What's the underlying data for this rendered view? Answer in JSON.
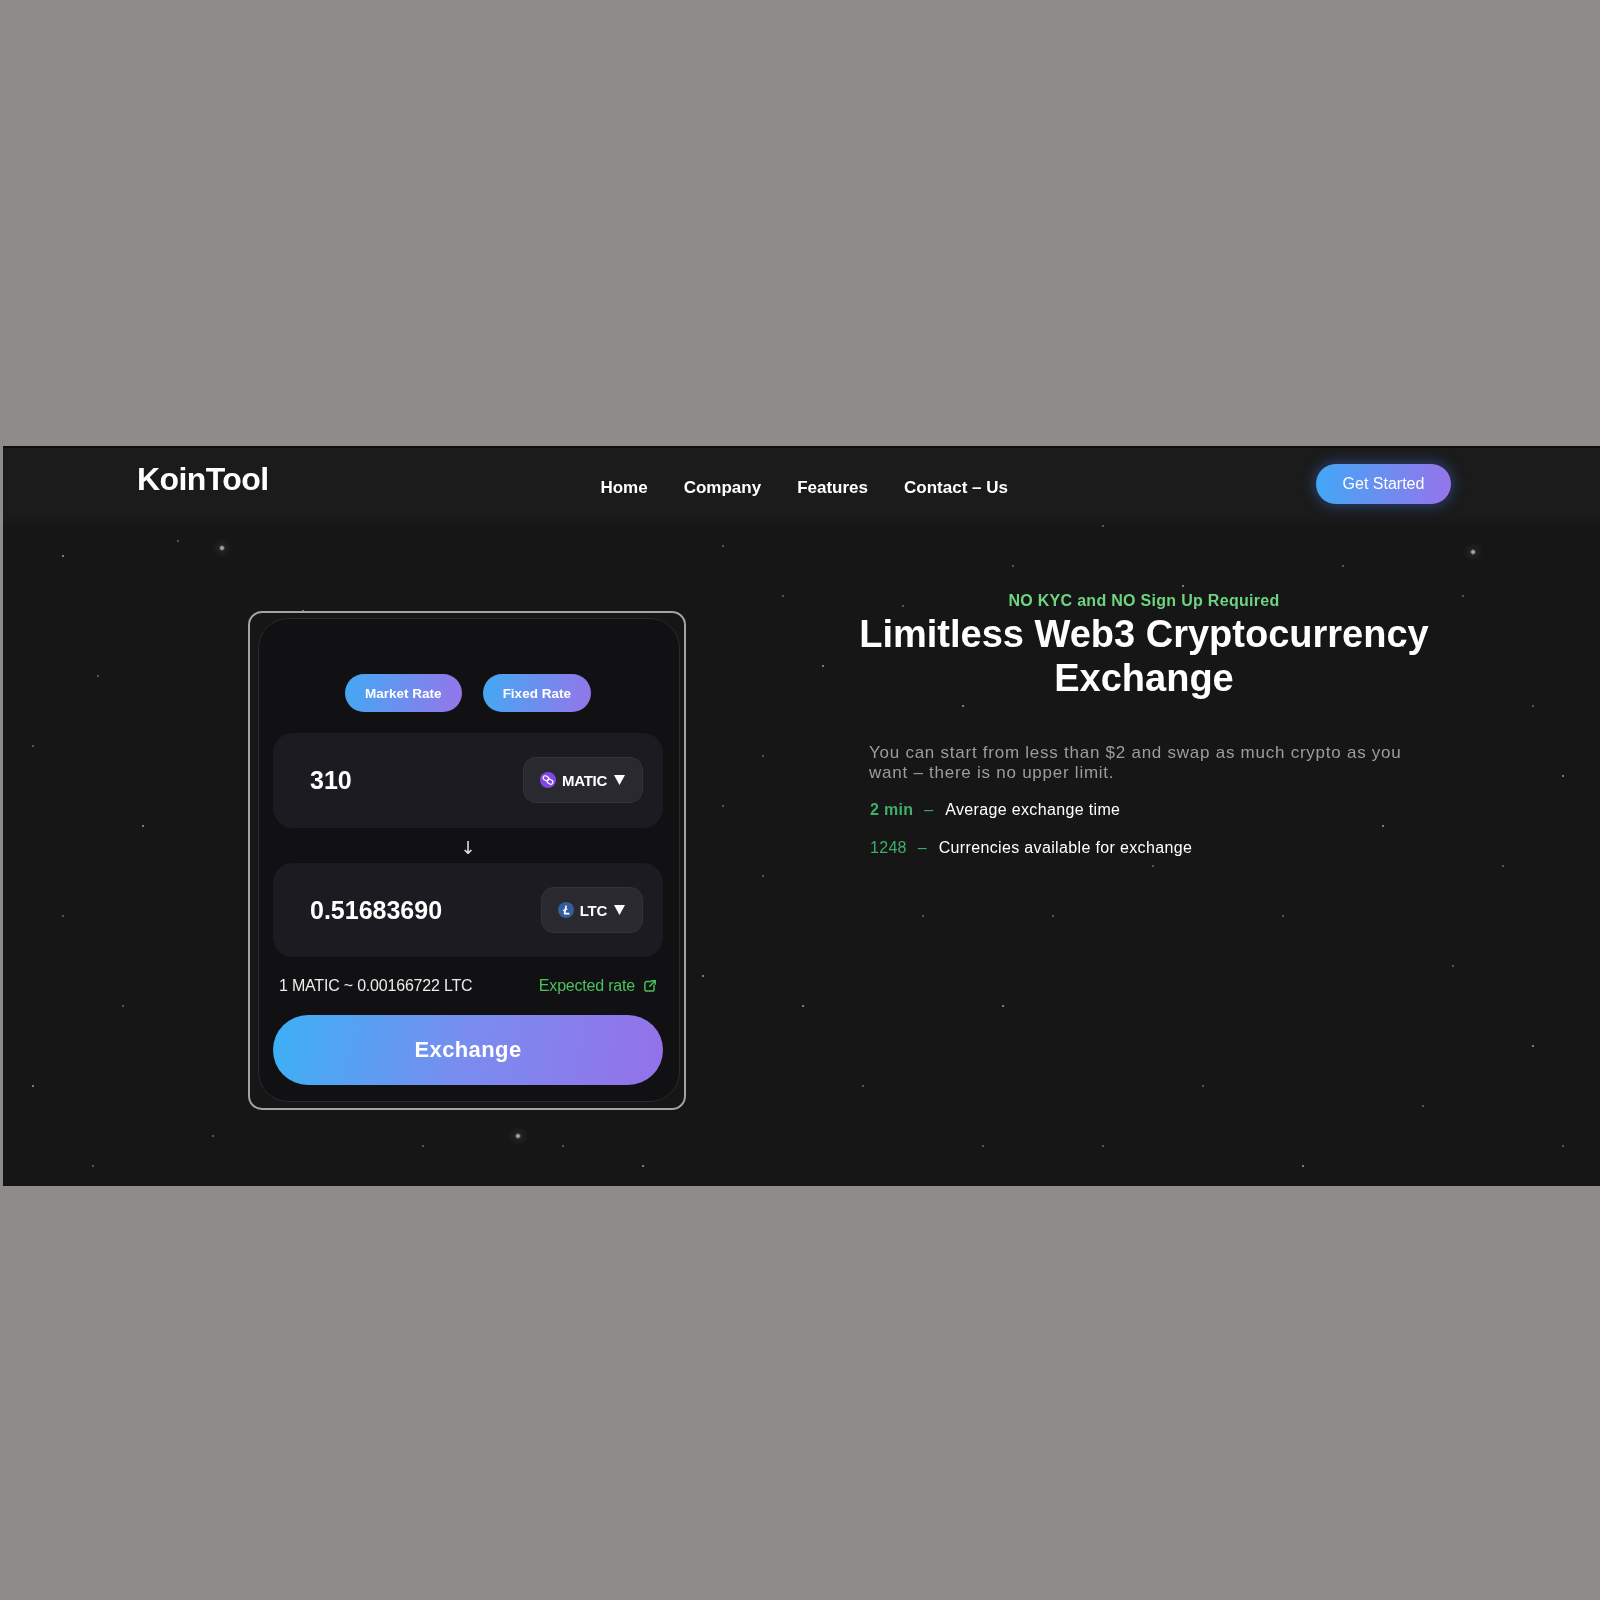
{
  "header": {
    "logo": "KoinTool",
    "nav": [
      "Home",
      "Company",
      "Features",
      "Contact – Us"
    ],
    "cta": "Get Started"
  },
  "exchange": {
    "rate_types": [
      "Market Rate",
      "Fixed Rate"
    ],
    "panels": [
      {
        "amount": "310",
        "currency": "MATIC",
        "kind": "chain",
        "color": "#8247e5"
      },
      {
        "amount": "0.51683690",
        "currency": "LTC",
        "kind": "lettermark",
        "color": "#345d9d"
      }
    ],
    "direction": "↓",
    "rate": "1 MATIC ~ 0.00166722 LTC",
    "rate_link": "Expected rate",
    "submit": "Exchange"
  },
  "hero": {
    "eyebrow": "NO KYC and NO Sign Up Required",
    "title": "Limitless Web3 Cryptocurrency Exchange",
    "description": "You can start from less than $2 and swap as much crypto as you want – there is no upper limit.",
    "stats": [
      {
        "value": "2 min",
        "strong": true,
        "separator": "–",
        "label": "Average exchange time"
      },
      {
        "value": "1248",
        "strong": false,
        "separator": "–",
        "label": "Currencies available for exchange"
      }
    ]
  }
}
